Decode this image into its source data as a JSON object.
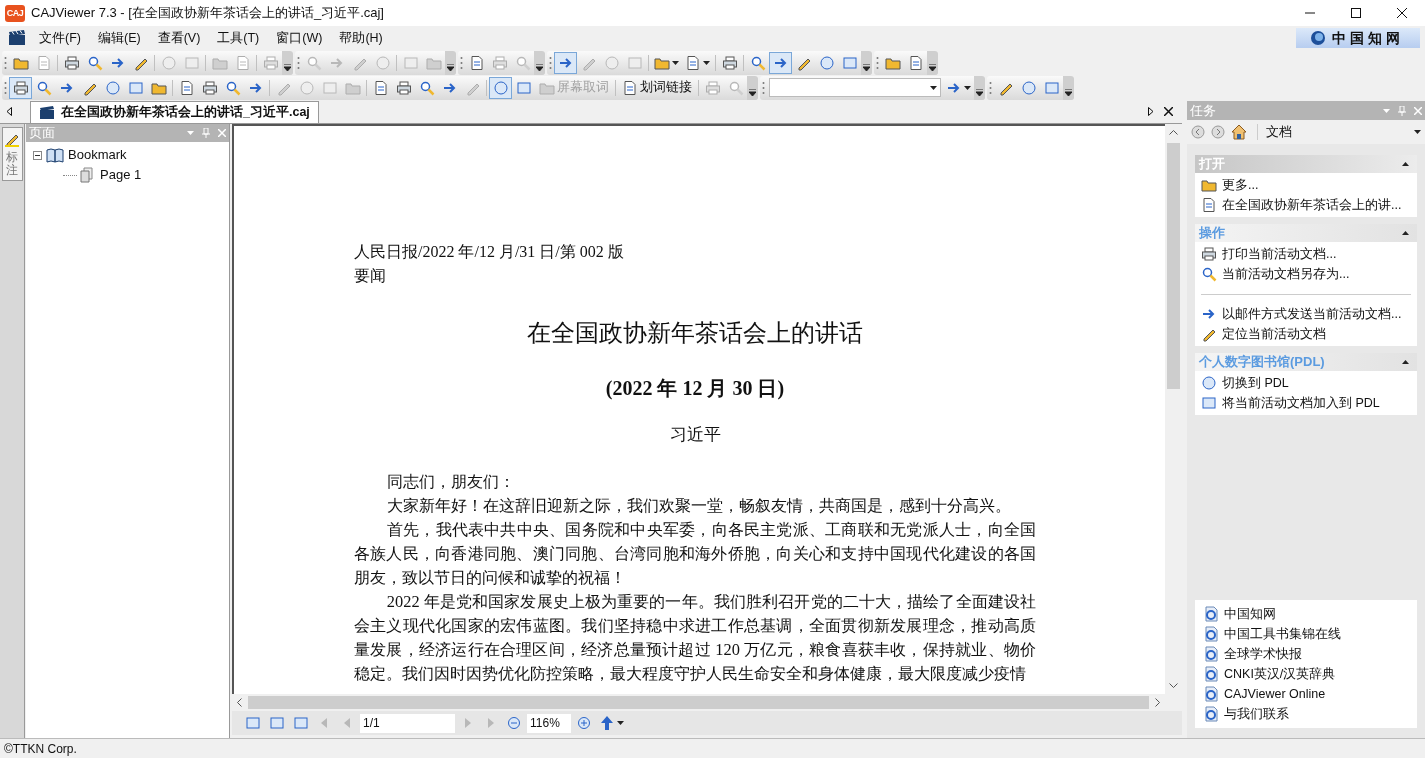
{
  "window": {
    "app_icon_text": "CAJ",
    "title": "CAJViewer 7.3 - [在全国政协新年茶话会上的讲话_习近平.caj]"
  },
  "menu": [
    "文件(F)",
    "编辑(E)",
    "查看(V)",
    "工具(T)",
    "窗口(W)",
    "帮助(H)"
  ],
  "logo": {
    "text": "中国知网"
  },
  "toolbars": [
    {
      "groups": [
        {
          "items": [
            {
              "kind": "icon",
              "disabled": false,
              "pressed": false
            },
            {
              "kind": "icon",
              "disabled": true,
              "pressed": false
            },
            {
              "kind": "separator"
            },
            {
              "kind": "icon",
              "disabled": false,
              "pressed": false
            },
            {
              "kind": "icon",
              "disabled": false,
              "pressed": false
            },
            {
              "kind": "icon",
              "disabled": false,
              "pressed": false
            },
            {
              "kind": "icon",
              "disabled": false,
              "pressed": false
            },
            {
              "kind": "separator"
            },
            {
              "kind": "icon",
              "disabled": true,
              "pressed": false
            },
            {
              "kind": "icon",
              "disabled": true,
              "pressed": false
            },
            {
              "kind": "separator"
            },
            {
              "kind": "icon",
              "disabled": true,
              "pressed": false
            },
            {
              "kind": "icon",
              "disabled": true,
              "pressed": false
            },
            {
              "kind": "separator"
            },
            {
              "kind": "icon",
              "disabled": true,
              "pressed": false
            }
          ]
        },
        {
          "items": [
            {
              "kind": "icon",
              "disabled": true,
              "pressed": false
            },
            {
              "kind": "icon",
              "disabled": true,
              "pressed": false
            },
            {
              "kind": "icon",
              "disabled": true,
              "pressed": false
            },
            {
              "kind": "icon",
              "disabled": true,
              "pressed": false
            },
            {
              "kind": "separator"
            },
            {
              "kind": "icon",
              "disabled": true,
              "pressed": false
            },
            {
              "kind": "icon",
              "disabled": true,
              "pressed": false
            }
          ]
        },
        {
          "items": [
            {
              "kind": "icon",
              "disabled": false,
              "pressed": false
            },
            {
              "kind": "icon",
              "disabled": true,
              "pressed": false
            },
            {
              "kind": "icon",
              "disabled": true,
              "pressed": false
            }
          ]
        },
        {
          "items": [
            {
              "kind": "icon",
              "disabled": false,
              "pressed": true
            },
            {
              "kind": "icon",
              "disabled": true,
              "pressed": false
            },
            {
              "kind": "icon",
              "disabled": true,
              "pressed": false
            },
            {
              "kind": "icon",
              "disabled": true,
              "pressed": false
            },
            {
              "kind": "separator"
            },
            {
              "kind": "dropdown",
              "disabled": false,
              "pressed": false
            },
            {
              "kind": "dropdown",
              "disabled": false,
              "pressed": false
            },
            {
              "kind": "separator"
            },
            {
              "kind": "icon",
              "disabled": false,
              "pressed": false
            },
            {
              "kind": "separator"
            },
            {
              "kind": "icon",
              "disabled": false,
              "pressed": false
            },
            {
              "kind": "icon",
              "disabled": false,
              "pressed": true
            },
            {
              "kind": "icon",
              "disabled": false,
              "pressed": false
            },
            {
              "kind": "icon",
              "disabled": false,
              "pressed": false
            },
            {
              "kind": "icon",
              "disabled": false,
              "pressed": false
            }
          ]
        },
        {
          "items": [
            {
              "kind": "icon",
              "disabled": false,
              "pressed": false
            },
            {
              "kind": "icon",
              "disabled": false,
              "pressed": false
            }
          ]
        }
      ]
    },
    {
      "groups": [
        {
          "items": [
            {
              "kind": "icon",
              "disabled": false,
              "pressed": true
            },
            {
              "kind": "icon",
              "disabled": false,
              "pressed": false
            },
            {
              "kind": "icon",
              "disabled": false,
              "pressed": false
            },
            {
              "kind": "icon",
              "disabled": false,
              "pressed": false
            },
            {
              "kind": "icon",
              "disabled": false,
              "pressed": false
            },
            {
              "kind": "icon",
              "disabled": false,
              "pressed": false
            },
            {
              "kind": "icon",
              "disabled": false,
              "pressed": false
            },
            {
              "kind": "separator"
            },
            {
              "kind": "icon",
              "disabled": false,
              "pressed": false
            },
            {
              "kind": "icon",
              "disabled": false,
              "pressed": false
            },
            {
              "kind": "icon",
              "disabled": false,
              "pressed": false
            },
            {
              "kind": "icon",
              "disabled": false,
              "pressed": false
            },
            {
              "kind": "separator"
            },
            {
              "kind": "icon",
              "disabled": true,
              "pressed": false
            },
            {
              "kind": "icon",
              "disabled": true,
              "pressed": false
            },
            {
              "kind": "icon",
              "disabled": true,
              "pressed": false
            },
            {
              "kind": "icon",
              "disabled": true,
              "pressed": false
            },
            {
              "kind": "separator"
            },
            {
              "kind": "icon",
              "disabled": false,
              "pressed": false
            },
            {
              "kind": "icon",
              "disabled": false,
              "pressed": false
            },
            {
              "kind": "icon",
              "disabled": false,
              "pressed": false
            },
            {
              "kind": "icon",
              "disabled": false,
              "pressed": false
            },
            {
              "kind": "icon",
              "disabled": true,
              "pressed": false
            },
            {
              "kind": "separator"
            },
            {
              "kind": "icon",
              "disabled": false,
              "pressed": true
            },
            {
              "kind": "icon",
              "disabled": false,
              "pressed": false
            },
            {
              "kind": "text",
              "label": "屏幕取词",
              "disabled": true,
              "pressed": false
            },
            {
              "kind": "separator"
            },
            {
              "kind": "text",
              "label": "划词链接",
              "disabled": false,
              "pressed": false
            },
            {
              "kind": "separator"
            },
            {
              "kind": "icon",
              "disabled": true,
              "pressed": false
            },
            {
              "kind": "icon",
              "disabled": true,
              "pressed": false
            }
          ]
        },
        {
          "items": [
            {
              "kind": "combo"
            },
            {
              "kind": "dropdown",
              "disabled": false,
              "pressed": false
            }
          ]
        },
        {
          "items": [
            {
              "kind": "icon",
              "disabled": false,
              "pressed": false
            },
            {
              "kind": "icon",
              "disabled": false,
              "pressed": false
            },
            {
              "kind": "icon",
              "disabled": false,
              "pressed": false
            }
          ]
        }
      ]
    }
  ],
  "document_tabs": [
    {
      "label": "在全国政协新年茶话会上的讲话_习近平.caj",
      "selected": true
    }
  ],
  "side_tabs": [
    {
      "label": "标注",
      "selected": true
    }
  ],
  "page_panel": {
    "title": "页面",
    "tree": [
      {
        "label": "Bookmark",
        "expanded": true,
        "children": [
          {
            "label": "Page 1"
          }
        ]
      }
    ]
  },
  "document": {
    "header_lines": [
      "人民日报/2022 年/12 月/31 日/第 002 版",
      "要闻"
    ],
    "title": "在全国政协新年茶话会上的讲话",
    "date": "(2022 年 12 月 30 日)",
    "author": "习近平",
    "paragraphs": [
      "同志们，朋友们：",
      "大家新年好！在这辞旧迎新之际，我们欢聚一堂，畅叙友情，共商国是，感到十分高兴。",
      "首先，我代表中共中央、国务院和中央军委，向各民主党派、工商联和无党派人士，向全国各族人民，向香港同胞、澳门同胞、台湾同胞和海外侨胞，向关心和支持中国现代化建设的各国朋友，致以节日的问候和诚挚的祝福！",
      "2022 年是党和国家发展史上极为重要的一年。我们胜利召开党的二十大，描绘了全面建设社会主义现代化国家的宏伟蓝图。我们坚持稳中求进工作总基调，全面贯彻新发展理念，推动高质量发展，经济运行在合理区间，经济总量预计超过 120 万亿元，粮食喜获丰收，保持就业、物价稳定。我们因时因势优化防控策略，最大程度守护人民生命安全和身体健康，最大限度减少疫情"
    ]
  },
  "navigator": {
    "view_buttons": [
      {
        "pressed": false
      },
      {
        "pressed": false
      },
      {
        "pressed": false
      }
    ],
    "back_buttons": [
      {
        "disabled": true
      },
      {
        "disabled": true
      }
    ],
    "page": "1/1",
    "forward_buttons": [
      {
        "disabled": true
      },
      {
        "disabled": true
      }
    ],
    "zoom": "116%"
  },
  "task_panel": {
    "title": "任务",
    "location": "文档",
    "sections": [
      {
        "title": "打开",
        "highlighted": true,
        "expanded": true,
        "items": [
          {
            "kind": "link",
            "label": "更多..."
          },
          {
            "kind": "link",
            "label": "在全国政协新年茶话会上的讲..."
          }
        ]
      },
      {
        "title": "操作",
        "highlighted": false,
        "expanded": true,
        "items": [
          {
            "kind": "link",
            "label": "打印当前活动文档..."
          },
          {
            "kind": "link",
            "label": "当前活动文档另存为..."
          },
          {
            "kind": "separator"
          },
          {
            "kind": "link",
            "label": "以邮件方式发送当前活动文档..."
          },
          {
            "kind": "link",
            "label": "定位当前活动文档"
          }
        ]
      },
      {
        "title": "个人数字图书馆(PDL)",
        "highlighted": false,
        "expanded": true,
        "items": [
          {
            "kind": "link",
            "label": "切换到 PDL"
          },
          {
            "kind": "link",
            "label": "将当前活动文档加入到 PDL"
          }
        ]
      }
    ],
    "links": [
      "中国知网",
      "中国工具书集锦在线",
      "全球学术快报",
      "CNKI英汉/汉英辞典",
      "CAJViewer Online",
      "与我们联系"
    ]
  },
  "status_bar": "©TTKN Corp."
}
